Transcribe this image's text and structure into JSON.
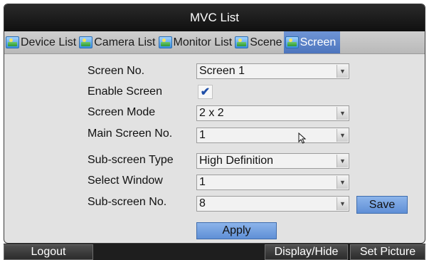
{
  "window": {
    "title": "MVC List"
  },
  "tabs": [
    {
      "label": "Device List",
      "active": false,
      "icon": "device-list-icon"
    },
    {
      "label": "Camera List",
      "active": false,
      "icon": "camera-list-icon"
    },
    {
      "label": "Monitor List",
      "active": false,
      "icon": "monitor-list-icon"
    },
    {
      "label": "Scene",
      "active": false,
      "icon": "scene-icon"
    },
    {
      "label": "Screen",
      "active": true,
      "icon": "screen-icon"
    }
  ],
  "form": {
    "screen_no": {
      "label": "Screen No.",
      "value": "Screen 1"
    },
    "enable_screen": {
      "label": "Enable Screen",
      "checked": true,
      "check_glyph": "✔"
    },
    "screen_mode": {
      "label": "Screen Mode",
      "value": "2 x 2"
    },
    "main_screen_no": {
      "label": "Main Screen No.",
      "value": "1"
    },
    "sub_screen_type": {
      "label": "Sub-screen Type",
      "value": "High Definition"
    },
    "select_window": {
      "label": "Select Window",
      "value": "1"
    },
    "sub_screen_no": {
      "label": "Sub-screen No.",
      "value": "8"
    },
    "dropdown_arrow": "▼",
    "save_label": "Save",
    "apply_label": "Apply"
  },
  "bottom": {
    "logout_label": "Logout",
    "display_hide_label": "Display/Hide",
    "set_picture_label": "Set Picture"
  },
  "colors": {
    "active_tab": "#4c74bd",
    "button": "#6f9ce0",
    "title_bar": "#1a1a1a"
  }
}
